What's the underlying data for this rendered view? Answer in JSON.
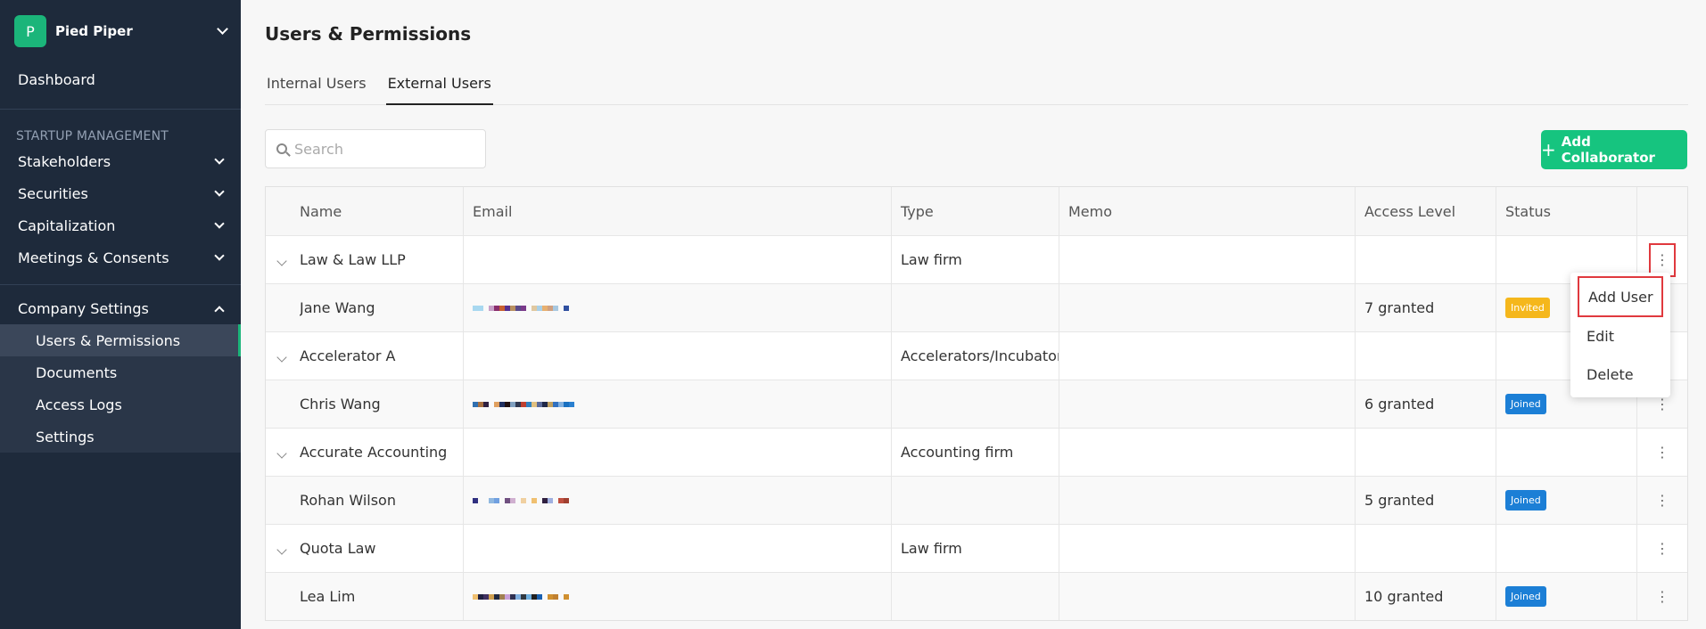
{
  "app": {
    "org_initial": "P",
    "org_name": "Pied Piper"
  },
  "sidebar": {
    "dashboard": "Dashboard",
    "section_label": "STARTUP MANAGEMENT",
    "items": [
      {
        "label": "Stakeholders"
      },
      {
        "label": "Securities"
      },
      {
        "label": "Capitalization"
      },
      {
        "label": "Meetings & Consents"
      }
    ],
    "company_settings": {
      "label": "Company Settings",
      "children": [
        {
          "label": "Users & Permissions",
          "active": true
        },
        {
          "label": "Documents"
        },
        {
          "label": "Access Logs"
        },
        {
          "label": "Settings"
        }
      ]
    }
  },
  "main": {
    "title": "Users & Permissions",
    "tabs": [
      {
        "label": "Internal Users",
        "active": false
      },
      {
        "label": "External Users",
        "active": true
      }
    ],
    "search_placeholder": "Search",
    "add_button": "Add Collaborator",
    "columns": {
      "name": "Name",
      "email": "Email",
      "type": "Type",
      "memo": "Memo",
      "access": "Access Level",
      "status": "Status"
    },
    "rows": [
      {
        "kind": "group",
        "name": "Law & Law LLP",
        "type": "Law firm"
      },
      {
        "kind": "user",
        "name": "Jane Wang",
        "access": "7 granted",
        "status": "Invited"
      },
      {
        "kind": "group",
        "name": "Accelerator A",
        "type": "Accelerators/Incubators"
      },
      {
        "kind": "user",
        "name": "Chris Wang",
        "access": "6 granted",
        "status": "Joined"
      },
      {
        "kind": "group",
        "name": "Accurate Accounting",
        "type": "Accounting firm"
      },
      {
        "kind": "user",
        "name": "Rohan Wilson",
        "access": "5 granted",
        "status": "Joined"
      },
      {
        "kind": "group",
        "name": "Quota Law",
        "type": "Law firm"
      },
      {
        "kind": "user",
        "name": "Lea Lim",
        "access": "10 granted",
        "status": "Joined"
      }
    ],
    "menu": [
      {
        "label": "Add User"
      },
      {
        "label": "Edit"
      },
      {
        "label": "Delete"
      }
    ]
  },
  "colors": {
    "sidebar_bg": "#1e2a3b",
    "accent": "#16c47f",
    "invited": "#f5b71c",
    "joined": "#1c7fd6",
    "highlight": "#e0393e"
  }
}
